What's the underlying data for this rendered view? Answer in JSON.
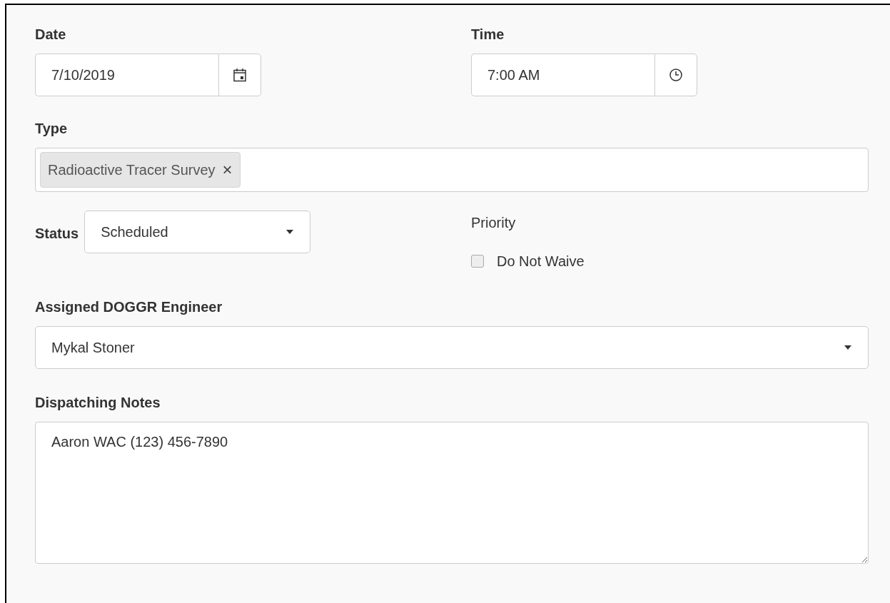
{
  "date": {
    "label": "Date",
    "value": "7/10/2019"
  },
  "time": {
    "label": "Time",
    "value": "7:00 AM"
  },
  "type": {
    "label": "Type",
    "tags": [
      {
        "text": "Radioactive Tracer Survey",
        "remove": "×"
      }
    ]
  },
  "status": {
    "label": "Status",
    "value": "Scheduled"
  },
  "priority": {
    "label": "Priority",
    "option": "Do Not Waive",
    "checked": false
  },
  "engineer": {
    "label": "Assigned DOGGR Engineer",
    "value": "Mykal Stoner"
  },
  "notes": {
    "label": "Dispatching Notes",
    "value": "Aaron WAC (123) 456-7890"
  }
}
